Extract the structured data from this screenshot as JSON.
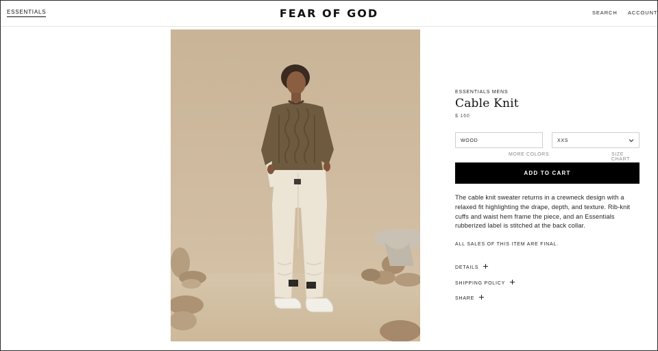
{
  "header": {
    "nav_left": "ESSENTIALS",
    "logo": "FEAR OF GOD",
    "search": "SEARCH",
    "account": "ACCOUNT"
  },
  "product": {
    "eyebrow": "ESSENTIALS MENS",
    "title": "Cable Knit",
    "price": "$ 160",
    "color_select": {
      "value": "WOOD",
      "icon": "chevron-down-icon"
    },
    "size_select": {
      "value": "XXS",
      "icon": "chevron-down-icon"
    },
    "more_colors": "MORE COLORS",
    "size_chart": "SIZE CHART",
    "add_to_cart": "ADD TO CART",
    "description": "The cable knit sweater returns in a crewneck design with a relaxed fit highlighting the drape, depth, and texture. Rib-knit cuffs and waist hem frame the piece, and an Essentials rubberized label is stitched at the back collar.",
    "final_sale": "ALL SALES OF THIS ITEM ARE FINAL.",
    "accordions": [
      {
        "label": "DETAILS",
        "icon": "plus-icon"
      },
      {
        "label": "SHIPPING POLICY",
        "icon": "plus-icon"
      },
      {
        "label": "SHARE",
        "icon": "plus-icon"
      }
    ]
  },
  "colors": {
    "background_wall": "#cdb89c",
    "floor": "#d8c8b0",
    "sweater": "#6e5a3f",
    "pants": "#ece4d4",
    "button": "#000000"
  }
}
